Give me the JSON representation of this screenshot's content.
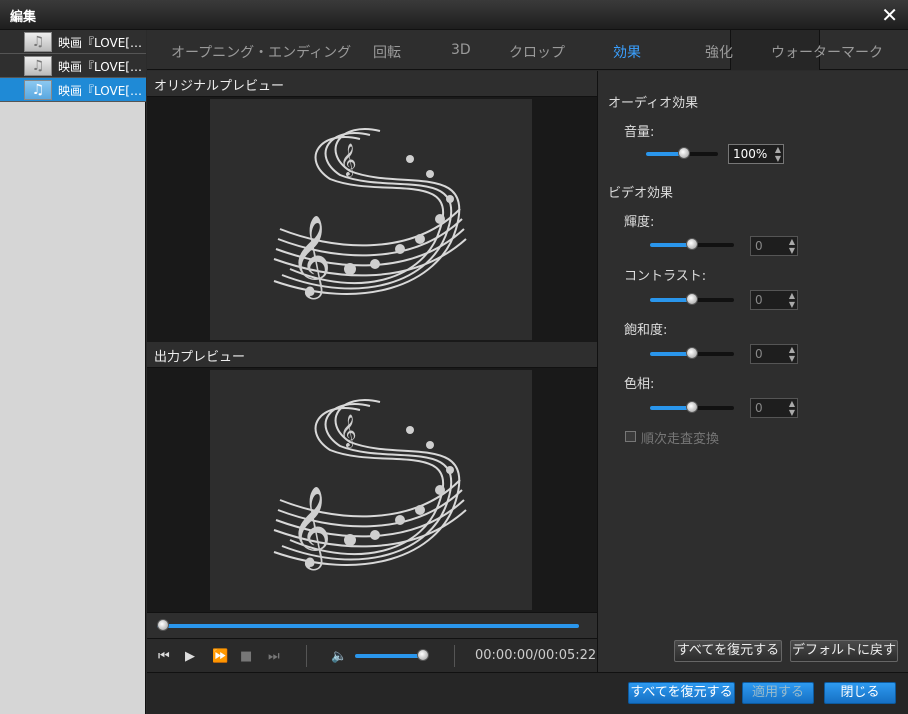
{
  "window": {
    "title": "編集"
  },
  "files": [
    {
      "name": "映画『LOVE[…",
      "selected": false
    },
    {
      "name": "映画『LOVE[…",
      "selected": false
    },
    {
      "name": "映画『LOVE[…",
      "selected": true
    }
  ],
  "tabs": [
    "オープニング・エンディング",
    "回転",
    "3D",
    "クロップ",
    "効果",
    "強化",
    "ウォーターマーク"
  ],
  "active_tab": "効果",
  "preview": {
    "original_label": "オリジナルプレビュー",
    "output_label": "出力プレビュー"
  },
  "player": {
    "time": "00:00:00/00:05:22",
    "seek_progress": 0.0,
    "volume_level": 0.85
  },
  "effects": {
    "audio_section": "オーディオ効果",
    "volume_label": "音量:",
    "volume_value": "100%",
    "volume_level": 0.5,
    "video_section": "ビデオ効果",
    "brightness_label": "輝度:",
    "brightness_value": "0",
    "contrast_label": "コントラスト:",
    "contrast_value": "0",
    "saturation_label": "飽和度:",
    "saturation_value": "0",
    "hue_label": "色相:",
    "hue_value": "0",
    "deinterlace_label": "順次走査変換",
    "restore_all": "すべてを復元する",
    "reset_default": "デフォルトに戻す"
  },
  "footer": {
    "restore_all": "すべてを復元する",
    "apply": "適用する",
    "close": "閉じる"
  },
  "colors": {
    "accent": "#2a96ec",
    "selected": "#1f8ad6"
  }
}
